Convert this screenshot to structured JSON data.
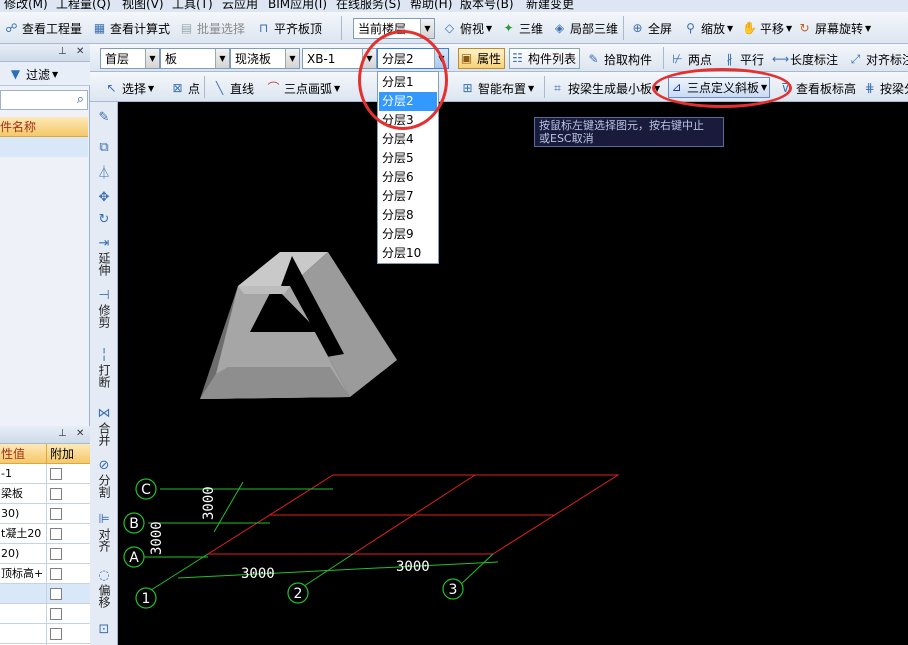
{
  "menu": [
    "修改(M)",
    "工程量(Q)",
    "视图(V)",
    "工具(T)",
    "云应用",
    "BIM应用(I)",
    "在线服务(S)",
    "帮助(H)",
    "版本号(B)",
    "新建变更"
  ],
  "toolbar1": {
    "view_quantity": "查看工程量",
    "view_formula": "查看计算式",
    "batch_select": "批量选择",
    "align_top": "平齐板顶",
    "floor_scope": "当前楼层",
    "top_view": "俯视",
    "three_d": "三维",
    "local_3d": "局部三维",
    "full_screen": "全屏",
    "zoom": "缩放",
    "pan": "平移",
    "screen_rotate": "屏幕旋转"
  },
  "toolbar2": {
    "floor": "首层",
    "component_type": "板",
    "component_sub": "现浇板",
    "component_name": "XB-1",
    "layer": "分层2",
    "properties": "属性",
    "component_list": "构件列表",
    "pick_component": "拾取构件",
    "two_points": "两点",
    "parallel": "平行",
    "length_dim": "长度标注",
    "align_dim": "对齐标注"
  },
  "toolbar3": {
    "select": "选择",
    "point": "点",
    "line": "直线",
    "three_point_arc": "三点画弧",
    "smart_layout": "智能布置",
    "gen_by_beam": "按梁生成最小板",
    "three_point_slope": "三点定义斜板",
    "view_slab_height": "查看板标高",
    "by_beam": "按梁分"
  },
  "left_panel": {
    "filter": "过滤",
    "column_header": "件名称",
    "prop_header_value": "性值",
    "prop_header_extra": "附加",
    "prop_values": [
      "-1",
      "梁板",
      "30)",
      "t凝土20",
      "20)",
      "顶标高+",
      "",
      "",
      "",
      ""
    ]
  },
  "vertical_tools": [
    "延伸",
    "修剪",
    "打断",
    "合并",
    "分割",
    "对齐",
    "偏移"
  ],
  "layer_dropdown": {
    "options": [
      "分层1",
      "分层2",
      "分层3",
      "分层4",
      "分层5",
      "分层6",
      "分层7",
      "分层8",
      "分层9",
      "分层10"
    ],
    "selected_index": 1
  },
  "tooltip": {
    "line1": "按鼠标左键选择图元，按右键中止",
    "line2": "或ESC取消"
  },
  "grid": {
    "row_labels": [
      "C",
      "B",
      "A"
    ],
    "col_labels": [
      "1",
      "2",
      "3"
    ],
    "dim_x1": "3000",
    "dim_x2": "3000",
    "dim_y1": "3000",
    "dim_y2": "3000"
  },
  "colors": {
    "canvas_bg": "#000000",
    "grid_green": "#22c02a",
    "slab_red": "#e02020",
    "highlight_red": "#e53030",
    "selection_blue": "#3399ff"
  }
}
